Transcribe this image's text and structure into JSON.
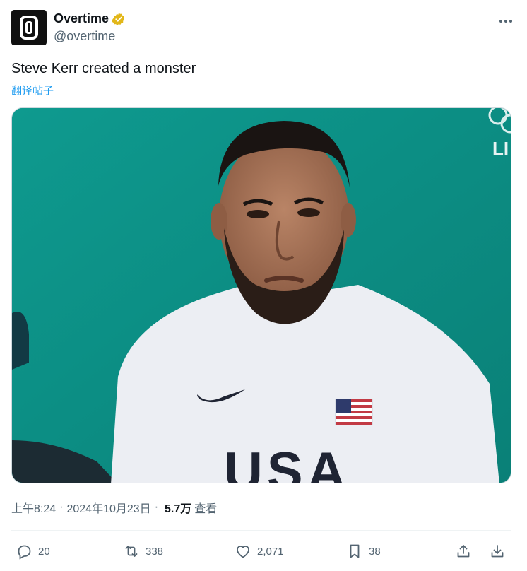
{
  "author": {
    "display_name": "Overtime",
    "handle": "@overtime",
    "verified_color": "#e2b719"
  },
  "tweet": {
    "text": "Steve Kerr created a monster",
    "translate_label": "翻译帖子"
  },
  "media": {
    "shirt_text": "USA",
    "corner_text": "LI"
  },
  "meta": {
    "time": "上午8:24",
    "date": "2024年10月23日",
    "views_count": "5.7万",
    "views_label": "查看",
    "separator": "·"
  },
  "actions": {
    "replies": "20",
    "reposts": "338",
    "likes": "2,071",
    "bookmarks": "38"
  },
  "colors": {
    "accent": "#1d9bf0",
    "muted": "#536471",
    "background_teal": "#0c8f85"
  }
}
